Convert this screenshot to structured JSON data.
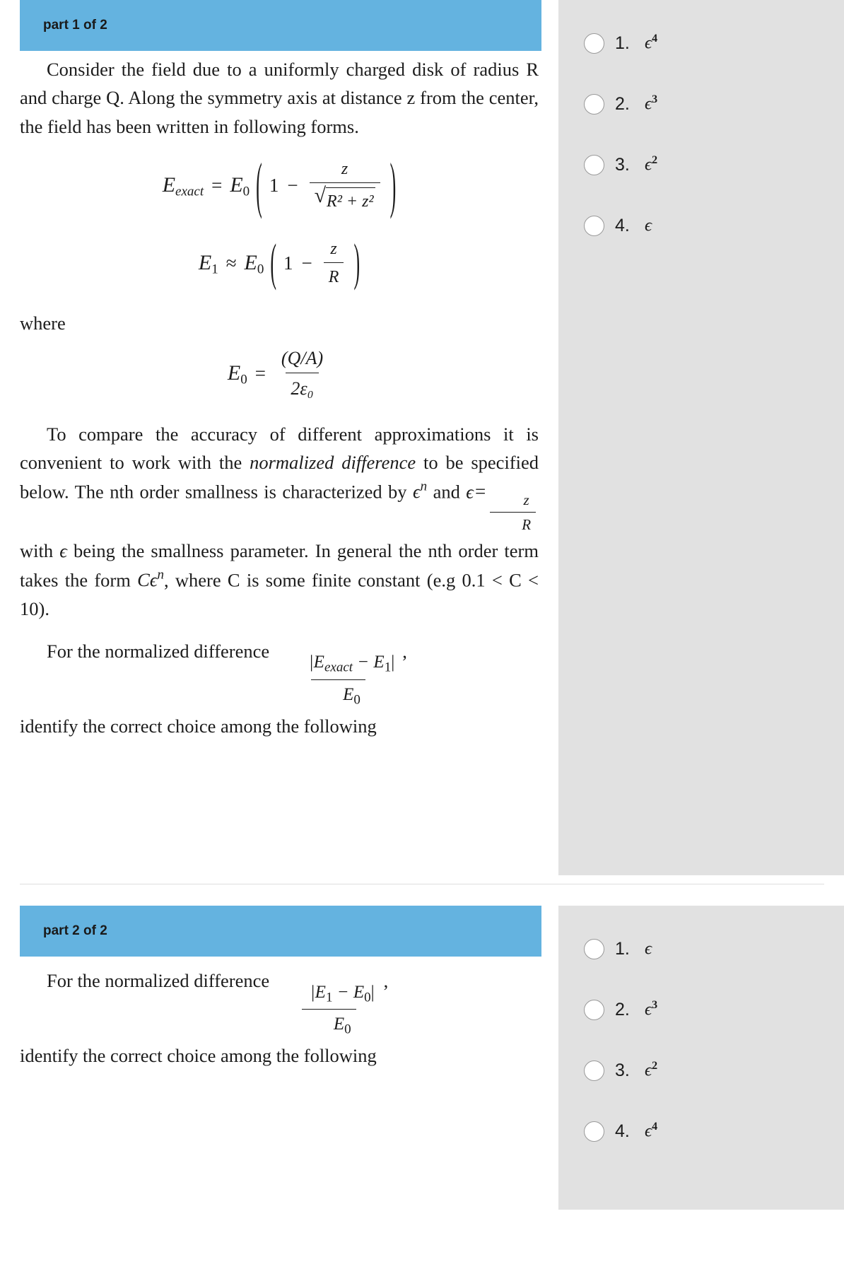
{
  "theme": {
    "header_bg": "#64b3e0",
    "answer_panel_bg": "#e1e1e1",
    "page_bg": "#ffffff",
    "text_color": "#1c1c1c",
    "radio_border": "#9a9a9a"
  },
  "parts": [
    {
      "header_label": "part 1 of 2",
      "paragraphs": {
        "intro": "Consider the field due to a uniformly charged disk of radius R and charge Q. Along the symmetry axis at distance z from the center, the field has been written in following forms.",
        "where_label": "where",
        "compare_1": "To compare the accuracy of different approximations it is convenient to work with the ",
        "compare_italic": "normalized difference",
        "compare_2": " to be specified below. The nth order smallness is characterized by ",
        "compare_3": " and ",
        "compare_4": " with ",
        "compare_5": " being the smallness parameter. In general the nth order term takes the form ",
        "compare_6": ", where C is some finite constant (e.g 0.1 < C < 10).",
        "prompt_lead": "For the normalized difference",
        "prompt_tail": "identify the correct choice among the following"
      },
      "equations": {
        "eq1": {
          "lhs_base": "E",
          "lhs_sub": "exact",
          "relation": "=",
          "prefactor_base": "E",
          "prefactor_sub": "0",
          "one": "1",
          "minus": "−",
          "frac_num": "z",
          "frac_den_root": "R² + z²"
        },
        "eq2": {
          "lhs_base": "E",
          "lhs_sub": "1",
          "relation": "≈",
          "prefactor_base": "E",
          "prefactor_sub": "0",
          "one": "1",
          "minus": "−",
          "frac_num": "z",
          "frac_den": "R"
        },
        "eq3": {
          "lhs_base": "E",
          "lhs_sub": "0",
          "relation": "=",
          "frac_num": "(Q/A)",
          "frac_den": "2ε₀"
        },
        "epsilon_n": "ϵ",
        "epsilon_n_sup": "n",
        "epsilon": "ϵ",
        "eps_def_num": "z",
        "eps_def_den": "R",
        "c_eps_n": "Cϵ",
        "c_eps_n_sup": "n",
        "norm_diff_num": "|E",
        "norm_diff_num_sub": "exact",
        "norm_diff_num_minus": " − E",
        "norm_diff_num_sub2": "1",
        "norm_diff_num_end": "|",
        "norm_diff_den": "E",
        "norm_diff_den_sub": "0",
        "trailing_comma": ","
      },
      "options": [
        {
          "number": "1.",
          "base": "ϵ",
          "exponent": "4"
        },
        {
          "number": "2.",
          "base": "ϵ",
          "exponent": "3"
        },
        {
          "number": "3.",
          "base": "ϵ",
          "exponent": "2"
        },
        {
          "number": "4.",
          "base": "ϵ",
          "exponent": ""
        }
      ]
    },
    {
      "header_label": "part 2 of 2",
      "paragraphs": {
        "prompt_lead": "For the normalized difference",
        "prompt_tail": "identify the correct choice among the following"
      },
      "equations": {
        "norm_diff_num": "|E",
        "norm_diff_num_sub": "1",
        "norm_diff_num_minus": " − E",
        "norm_diff_num_sub2": "0",
        "norm_diff_num_end": "|",
        "norm_diff_den": "E",
        "norm_diff_den_sub": "0",
        "trailing_comma": ","
      },
      "options": [
        {
          "number": "1.",
          "base": "ϵ",
          "exponent": ""
        },
        {
          "number": "2.",
          "base": "ϵ",
          "exponent": "3"
        },
        {
          "number": "3.",
          "base": "ϵ",
          "exponent": "2"
        },
        {
          "number": "4.",
          "base": "ϵ",
          "exponent": "4"
        }
      ]
    }
  ]
}
